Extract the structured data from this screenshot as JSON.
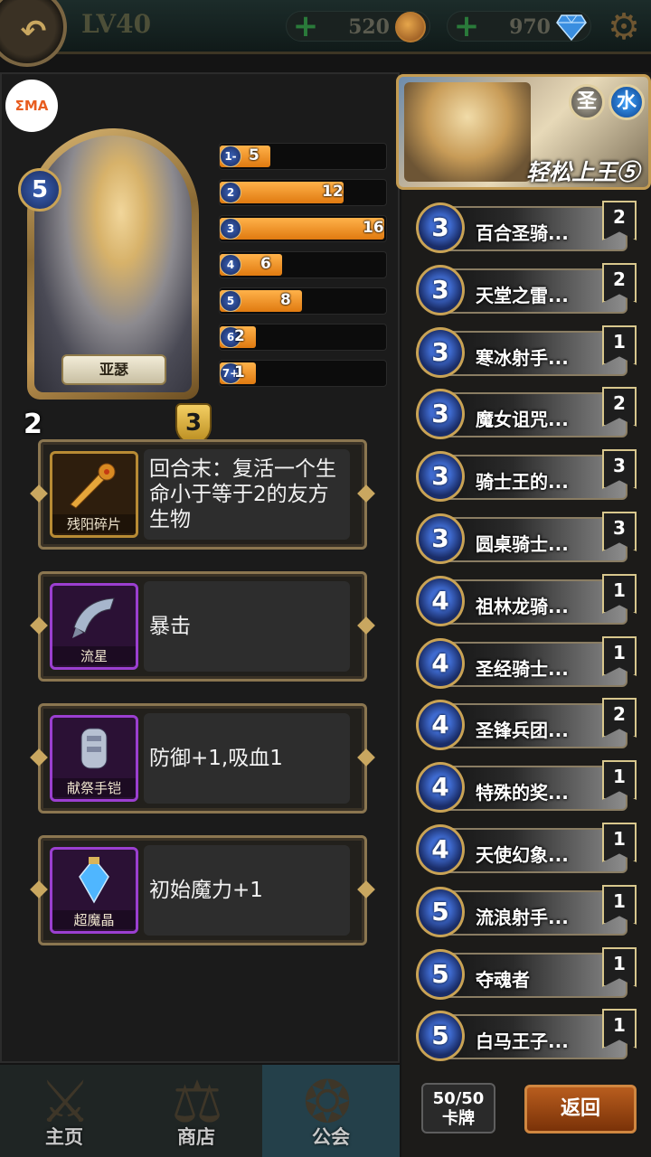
{
  "topbar": {
    "level": "LV40",
    "gold": "520",
    "gems": "970",
    "back_icon": "back-arrow-icon",
    "settings_icon": "gear-icon"
  },
  "logo": "ΣMA",
  "hero": {
    "name": "亚瑟",
    "cost": "5",
    "attack": "2",
    "health": "3"
  },
  "mana_curve": [
    {
      "cost": "1-",
      "count": "5",
      "fraction": 0.31
    },
    {
      "cost": "2",
      "count": "12",
      "fraction": 0.75
    },
    {
      "cost": "3",
      "count": "16",
      "fraction": 1.0
    },
    {
      "cost": "4",
      "count": "6",
      "fraction": 0.38
    },
    {
      "cost": "5",
      "count": "8",
      "fraction": 0.5
    },
    {
      "cost": "6",
      "count": "2",
      "fraction": 0.12
    },
    {
      "cost": "7+",
      "count": "1",
      "fraction": 0.06
    }
  ],
  "equipment": [
    {
      "name": "残阳碎片",
      "desc": "回合末：复活一个生命小于等于2的友方生物",
      "rarity": "gold"
    },
    {
      "name": "流星",
      "desc": "暴击",
      "rarity": "purple"
    },
    {
      "name": "献祭手铠",
      "desc": "防御+1,吸血1",
      "rarity": "purple"
    },
    {
      "name": "超魔晶",
      "desc": "初始魔力+1",
      "rarity": "purple"
    }
  ],
  "deck": {
    "title": "轻松上王⑤",
    "badge_holy": "圣",
    "badge_water": "水",
    "cards": [
      {
        "cost": "3",
        "name": "百合圣骑...",
        "qty": "2"
      },
      {
        "cost": "3",
        "name": "天堂之雷...",
        "qty": "2"
      },
      {
        "cost": "3",
        "name": "寒冰射手...",
        "qty": "1"
      },
      {
        "cost": "3",
        "name": "魔女诅咒...",
        "qty": "2"
      },
      {
        "cost": "3",
        "name": "骑士王的...",
        "qty": "3"
      },
      {
        "cost": "3",
        "name": "圆桌骑士...",
        "qty": "3"
      },
      {
        "cost": "4",
        "name": "祖林龙骑...",
        "qty": "1"
      },
      {
        "cost": "4",
        "name": "圣经骑士...",
        "qty": "1"
      },
      {
        "cost": "4",
        "name": "圣锋兵团...",
        "qty": "2"
      },
      {
        "cost": "4",
        "name": "特殊的奖...",
        "qty": "1"
      },
      {
        "cost": "4",
        "name": "天使幻象...",
        "qty": "1"
      },
      {
        "cost": "5",
        "name": "流浪射手...",
        "qty": "1"
      },
      {
        "cost": "5",
        "name": "夺魂者",
        "qty": "1"
      },
      {
        "cost": "5",
        "name": "白马王子...",
        "qty": "1"
      }
    ],
    "count_value": "50/50",
    "count_label": "卡牌",
    "return_label": "返回"
  },
  "tabs": [
    {
      "label": "主页",
      "icon": "crossed-swords-icon"
    },
    {
      "label": "商店",
      "icon": "scales-icon"
    },
    {
      "label": "公会",
      "icon": "guild-crest-icon",
      "active": true
    }
  ]
}
